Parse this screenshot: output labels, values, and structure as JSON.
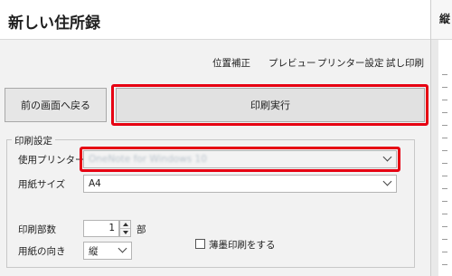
{
  "window": {
    "title": "新しい住所録"
  },
  "menu": {
    "items": [
      "位置補正",
      "プレビュー",
      "プリンター設定",
      "試し印刷"
    ]
  },
  "actions": {
    "back_label": "前の画面へ戻る",
    "print_label": "印刷実行"
  },
  "print_settings": {
    "legend": "印刷設定",
    "printer": {
      "label": "使用プリンター",
      "value": "OneNote for Windows 10"
    },
    "paper_size": {
      "label": "用紙サイズ",
      "value": "A4"
    },
    "copies": {
      "label": "印刷部数",
      "value": "1",
      "unit": "部"
    },
    "orientation": {
      "label": "用紙の向き",
      "value": "縦"
    },
    "thin_ink": {
      "label": "薄墨印刷をする",
      "checked": false
    }
  },
  "preview": {
    "orientation_label": "縦"
  },
  "highlight_color": "#e60012"
}
